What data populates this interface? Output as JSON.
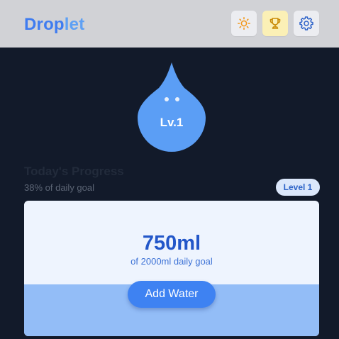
{
  "header": {
    "brand_part1": "Drop",
    "brand_part2": "let",
    "buttons": [
      {
        "icon": "sun-icon",
        "label": "Theme"
      },
      {
        "icon": "trophy-icon",
        "label": "Achievements"
      },
      {
        "icon": "gear-icon",
        "label": "Settings"
      }
    ]
  },
  "mascot": {
    "level_label": "Lv.1"
  },
  "progress": {
    "title": "Today's Progress",
    "subtitle": "38% of daily goal",
    "percent": 38,
    "level_badge": "Level 1"
  },
  "card": {
    "amount": "750ml",
    "goal_text": "of 2000ml daily goal",
    "add_button_label": "Add Water"
  },
  "colors": {
    "brand_blue": "#3f7cf0",
    "brand_light_blue": "#5ea0f4",
    "background": "#121a2a",
    "header_bg": "#d1d2d6",
    "droplet": "#5b9ef5",
    "accent_button": "#3e82f2",
    "water_fill": "#93bdf7"
  }
}
